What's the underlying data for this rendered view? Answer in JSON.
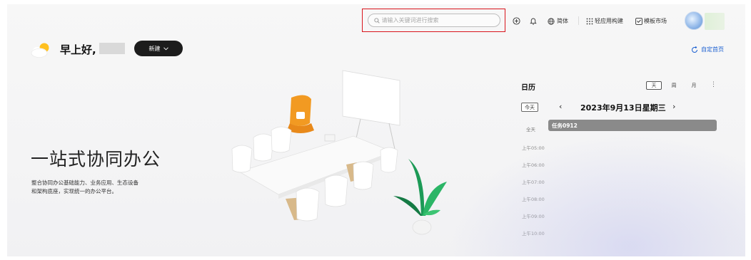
{
  "search": {
    "placeholder": "请输入关键词进行搜索"
  },
  "topbar": {
    "add_icon": "plus-circle-icon",
    "bell_icon": "bell-icon",
    "language_label": "简体",
    "light_app_label": "轻应用构建",
    "template_market_label": "模板市场"
  },
  "greeting": {
    "text": "早上好,"
  },
  "new_button": {
    "label": "新建"
  },
  "customize": {
    "label": "自定首页"
  },
  "hero": {
    "title": "一站式协同办公",
    "description_line1": "整合协同办公基础能力、业务应用、生态设备",
    "description_line2": "和架构底座，实现统一的办公平台。"
  },
  "calendar": {
    "title": "日历",
    "views": [
      "天",
      "周",
      "月"
    ],
    "active_view": "天",
    "more": "⋮",
    "today_label": "今天",
    "prev": "‹",
    "next": "›",
    "date": "2023年9月13日星期三",
    "allday_label": "全天",
    "allday_event": "任务0912",
    "slots": [
      "上午05:00",
      "上午06:00",
      "上午07:00",
      "上午08:00",
      "上午09:00",
      "上午10:00"
    ]
  },
  "colors": {
    "accent_red": "#d9141c",
    "link_blue": "#1a5fd0",
    "button_dark": "#1c1c1c",
    "event_gray": "#8a8a8a"
  }
}
